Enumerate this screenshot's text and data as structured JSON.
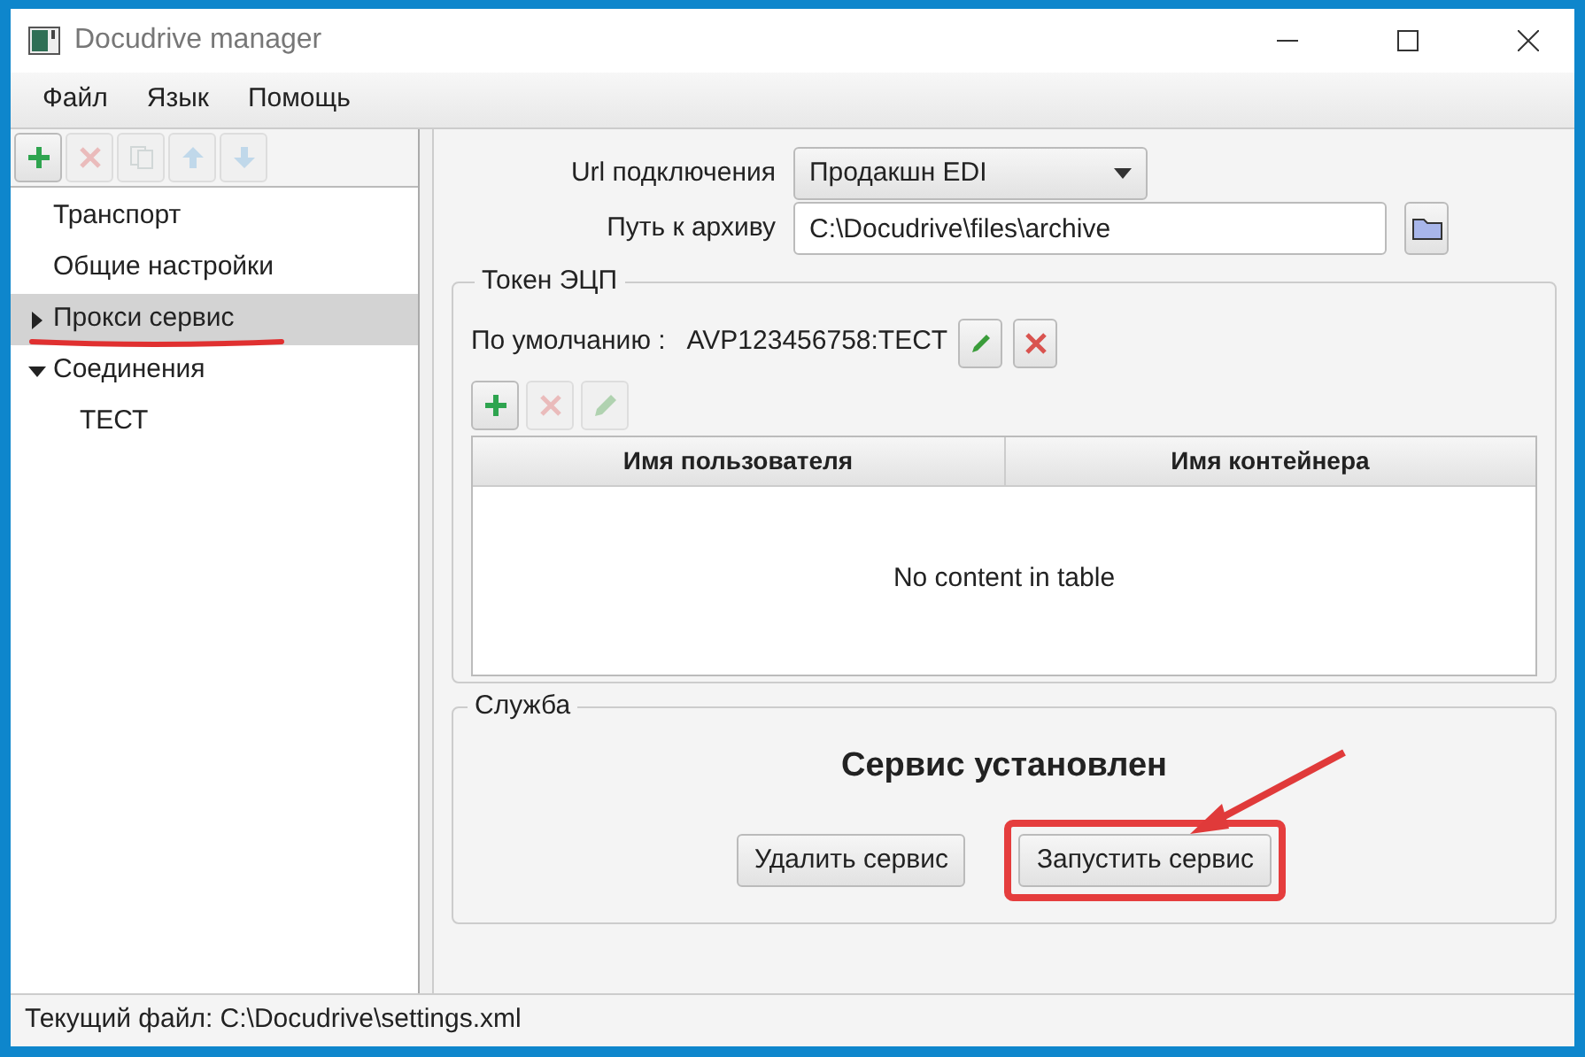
{
  "window": {
    "title": "Docudrive manager"
  },
  "menu": [
    "Файл",
    "Язык",
    "Помощь"
  ],
  "sidebar": {
    "toolbar": [
      {
        "kind": "add",
        "disabled": false
      },
      {
        "kind": "delete",
        "disabled": true
      },
      {
        "kind": "copy",
        "disabled": true
      },
      {
        "kind": "up",
        "disabled": true
      },
      {
        "kind": "down",
        "disabled": true
      }
    ],
    "items": [
      {
        "label": "Транспорт",
        "selected": false
      },
      {
        "label": "Общие настройки",
        "selected": false
      },
      {
        "label": "Прокси сервис",
        "selected": true,
        "expanded": false
      },
      {
        "label": "Соединения",
        "selected": false,
        "expanded": true,
        "children": [
          {
            "label": "ТЕСТ",
            "selected": false
          }
        ]
      }
    ]
  },
  "settings": {
    "url_label": "Url подключения",
    "url_value": "Продакшн EDI",
    "archive_label": "Путь к архиву",
    "archive_value": "C:\\Docudrive\\files\\archive"
  },
  "token": {
    "legend": "Токен ЭЦП",
    "default_label": "По умолчанию :",
    "default_value": "AVP123456758:TECT",
    "toolbar": [
      {
        "kind": "add",
        "disabled": false
      },
      {
        "kind": "delete",
        "disabled": true
      },
      {
        "kind": "edit",
        "disabled": true
      }
    ],
    "table": {
      "columns": [
        "Имя пользователя",
        "Имя контейнера"
      ],
      "placeholder": "No content in table"
    }
  },
  "service": {
    "legend": "Служба",
    "status": "Сервис установлен",
    "buttons": [
      {
        "label": "Удалить сервис",
        "highlighted": false
      },
      {
        "label": "Запустить сервис",
        "highlighted": true
      }
    ]
  },
  "status_bar": "Текущий файл: C:\\Docudrive\\settings.xml"
}
